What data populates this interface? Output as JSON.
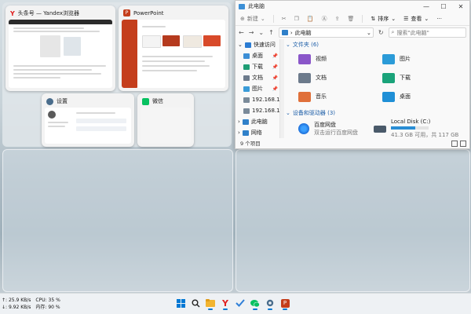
{
  "snap_windows": [
    {
      "title": "头条号 — Yandex浏览器",
      "icon": "yandex-icon"
    },
    {
      "title": "PowerPoint",
      "icon": "powerpoint-icon"
    },
    {
      "title": "设置",
      "icon": "settings-gear-icon"
    },
    {
      "title": "微信",
      "icon": "wechat-icon"
    }
  ],
  "explorer": {
    "title": "此电脑",
    "toolbar": {
      "new": "新建",
      "sort": "排序",
      "view": "查看",
      "more": "···"
    },
    "address_path": "此电脑",
    "search_placeholder": "搜索\"此电脑\"",
    "sidebar": [
      {
        "label": "快速访问",
        "icon": "star-icon",
        "color": "#2b7cd3",
        "pinned": false
      },
      {
        "label": "桌面",
        "icon": "desktop-folder-icon",
        "color": "#3d8fd6",
        "pinned": true
      },
      {
        "label": "下载",
        "icon": "download-folder-icon",
        "color": "#1f9e75",
        "pinned": true
      },
      {
        "label": "文档",
        "icon": "document-folder-icon",
        "color": "#6d7b8c",
        "pinned": true
      },
      {
        "label": "图片",
        "icon": "picture-folder-icon",
        "color": "#3a9bd8",
        "pinned": true
      },
      {
        "label": "192.168.1",
        "icon": "network-drive-icon",
        "color": "#7a8a99",
        "pinned": true
      },
      {
        "label": "192.168.1",
        "icon": "network-drive-icon",
        "color": "#7a8a99",
        "pinned": true
      },
      {
        "label": "此电脑",
        "icon": "computer-icon",
        "color": "#2f80c9",
        "pinned": false
      },
      {
        "label": "网络",
        "icon": "network-icon",
        "color": "#2f80c9",
        "pinned": false
      }
    ],
    "folders_section": "文件夹 (6)",
    "folders": [
      {
        "label": "视频",
        "icon": "videos-folder-icon",
        "color": "#8a56c9"
      },
      {
        "label": "图片",
        "icon": "pictures-folder-icon",
        "color": "#2b9bd8"
      },
      {
        "label": "文档",
        "icon": "documents-folder-icon",
        "color": "#6c7a8b"
      },
      {
        "label": "下载",
        "icon": "downloads-folder-icon",
        "color": "#1aa37a"
      },
      {
        "label": "音乐",
        "icon": "music-folder-icon",
        "color": "#e0703a"
      },
      {
        "label": "桌面",
        "icon": "desktop-folder-icon",
        "color": "#1f8fd6"
      }
    ],
    "devices_section": "设备和驱动器 (3)",
    "devices": [
      {
        "label": "百度网盘",
        "sublabel": "双击运行百度网盘",
        "icon": "baidu-netdisk-icon"
      },
      {
        "label": "Local Disk (C:)",
        "sublabel": "41.3 GB 可用，共 117 GB",
        "icon": "drive-c-icon",
        "used_fraction": 0.65
      }
    ],
    "status": "9 个项目"
  },
  "taskbar": {
    "stats": {
      "up": "↑: 25.9 KB/s",
      "down": "↓: 9.92 KB/s",
      "cpu": "CPU: 35 %",
      "mem": "内存: 90 %"
    },
    "icons": [
      {
        "name": "windows-start-icon",
        "color": "#0078d4"
      },
      {
        "name": "search-icon",
        "color": "#222222"
      },
      {
        "name": "file-explorer-icon",
        "color": "#f2b531"
      },
      {
        "name": "yandex-browser-icon",
        "color": "#e02020"
      },
      {
        "name": "todo-check-icon",
        "color": "#2f7fd8"
      },
      {
        "name": "wechat-icon",
        "color": "#07c160"
      },
      {
        "name": "settings-gear-icon",
        "color": "#4a6d8c"
      },
      {
        "name": "powerpoint-icon",
        "color": "#c43e1c"
      }
    ]
  }
}
